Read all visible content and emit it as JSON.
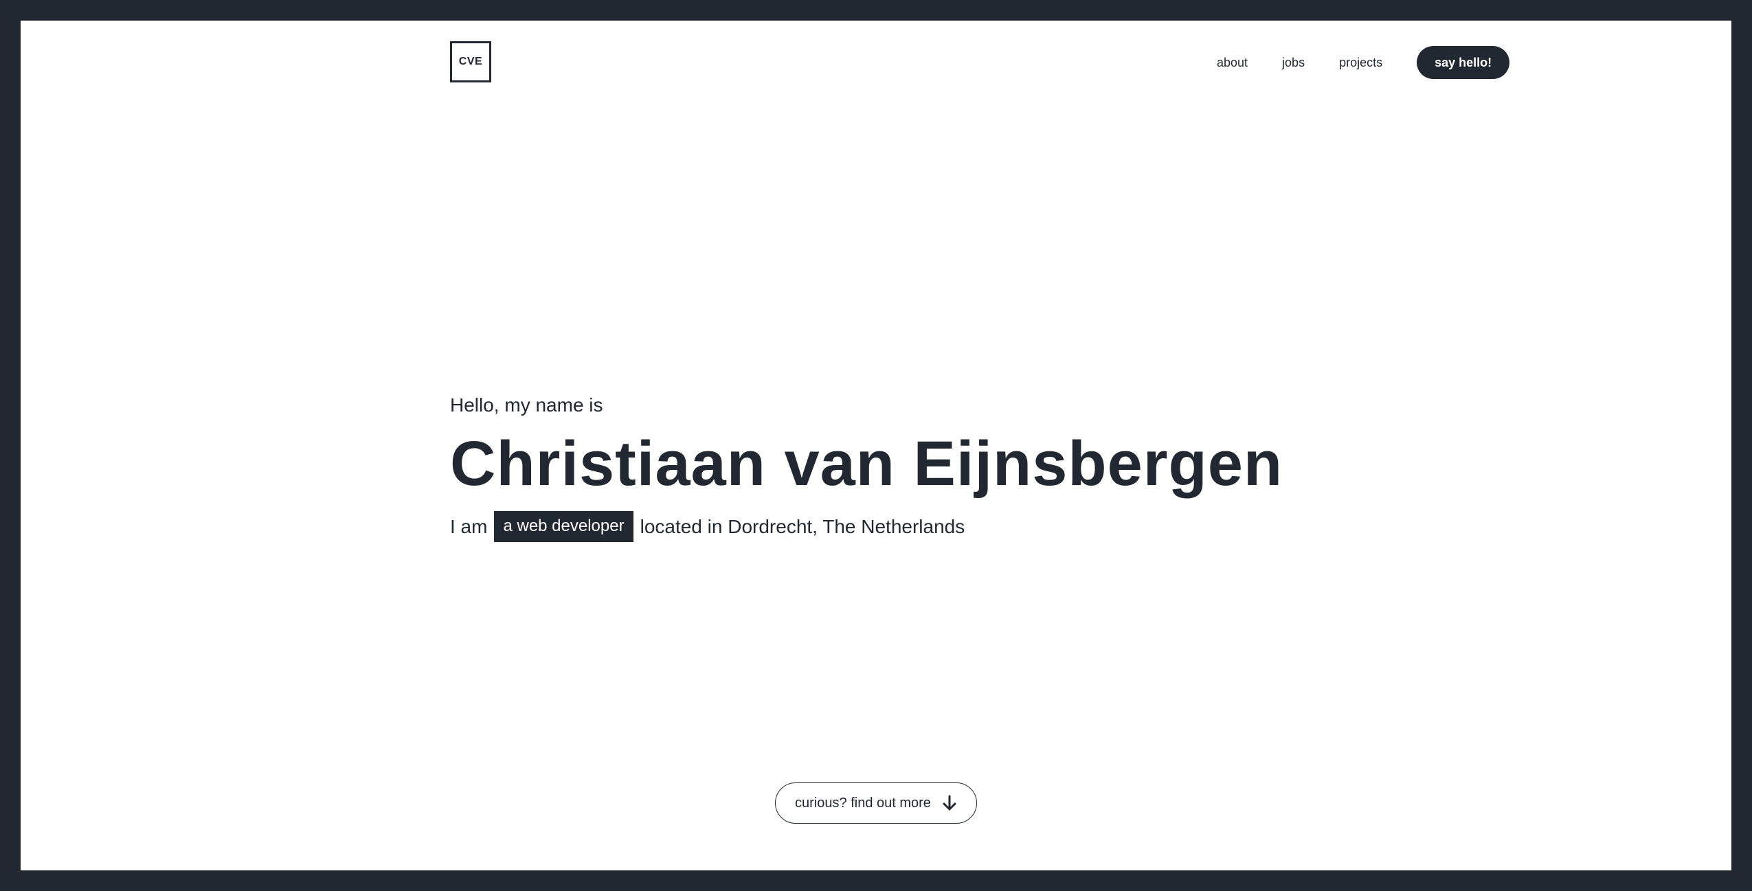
{
  "header": {
    "logo_text": "CVE",
    "nav": [
      {
        "label": "about"
      },
      {
        "label": "jobs"
      },
      {
        "label": "projects"
      }
    ],
    "cta_label": "say hello!"
  },
  "hero": {
    "greeting": "Hello, my name is",
    "name": "Christiaan van Eijnsbergen",
    "intro_prefix": "I am",
    "role": "a web developer",
    "intro_suffix": "located in Dordrecht, The Netherlands"
  },
  "scroll_cta": {
    "label": "curious? find out more",
    "icon": "arrow-down-icon"
  },
  "colors": {
    "dark": "#222831",
    "light": "#ffffff"
  }
}
